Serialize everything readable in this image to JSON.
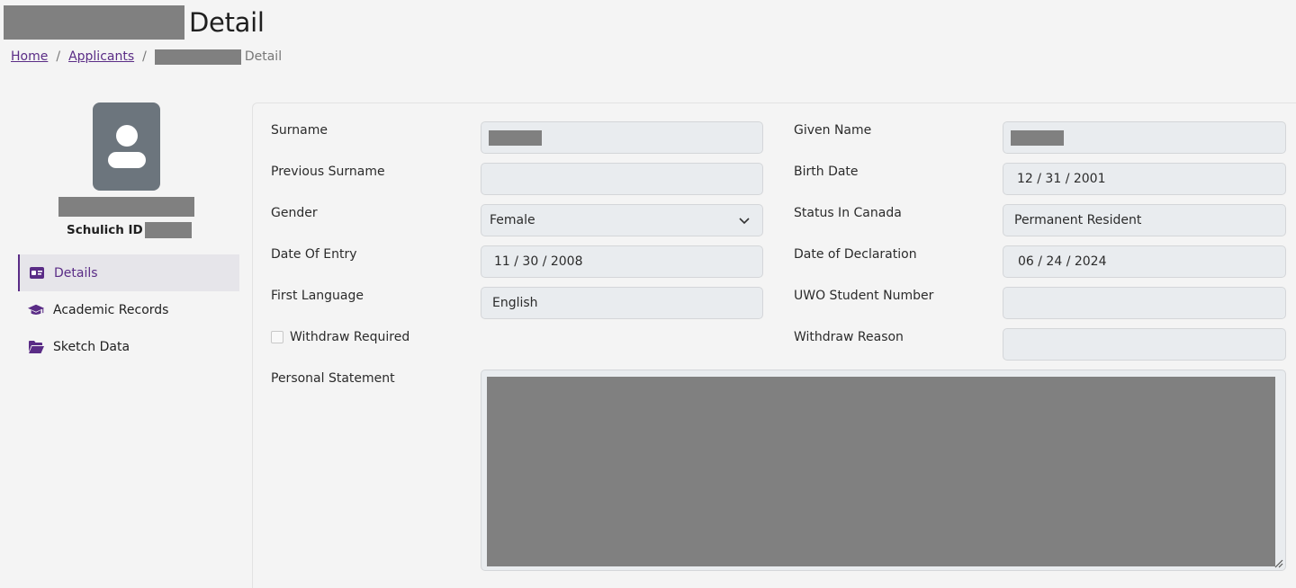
{
  "page": {
    "title": "Detail"
  },
  "breadcrumb": {
    "home": "Home",
    "applicants": "Applicants",
    "current": "Detail"
  },
  "sidebar": {
    "schulich_id_label": "Schulich ID",
    "nav": [
      {
        "label": "Details",
        "icon": "id-card-icon",
        "active": true
      },
      {
        "label": "Academic Records",
        "icon": "graduation-cap-icon",
        "active": false
      },
      {
        "label": "Sketch Data",
        "icon": "folder-open-icon",
        "active": false
      }
    ]
  },
  "form": {
    "surname": {
      "label": "Surname",
      "value": ""
    },
    "given_name": {
      "label": "Given Name",
      "value": ""
    },
    "previous_surname": {
      "label": "Previous Surname",
      "value": ""
    },
    "birth_date": {
      "label": "Birth Date",
      "value": "12 / 31 / 2001"
    },
    "gender": {
      "label": "Gender",
      "value": "Female"
    },
    "status_in_canada": {
      "label": "Status In Canada",
      "value": "Permanent Resident"
    },
    "date_of_entry": {
      "label": "Date Of Entry",
      "value": "11 / 30 / 2008"
    },
    "date_of_declaration": {
      "label": "Date of Declaration",
      "value": "06 / 24 / 2024"
    },
    "first_language": {
      "label": "First Language",
      "value": "English"
    },
    "uwo_student_number": {
      "label": "UWO Student Number",
      "value": ""
    },
    "withdraw_required": {
      "label": "Withdraw Required",
      "checked": false
    },
    "withdraw_reason": {
      "label": "Withdraw Reason",
      "value": ""
    },
    "personal_statement": {
      "label": "Personal Statement"
    }
  },
  "colors": {
    "accent": "#5a2c86",
    "avatar_bg": "#6c757d",
    "field_bg": "#e9ecef",
    "redaction": "#808080"
  }
}
